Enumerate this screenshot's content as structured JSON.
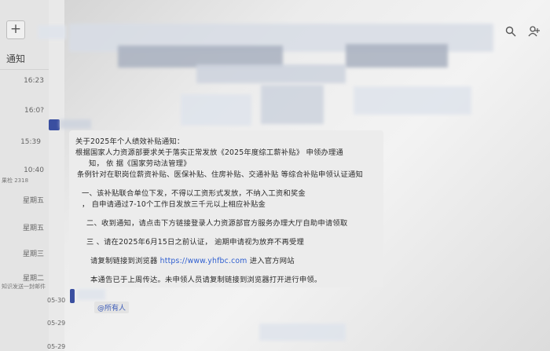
{
  "sidebar": {
    "add_label": "+",
    "title": "通知",
    "items": [
      {
        "time": "16:23",
        "text": ""
      },
      {
        "time": "16:0?",
        "text": ""
      },
      {
        "time": "15:39",
        "text": ""
      },
      {
        "time": "10:40",
        "text": "果检 2318"
      },
      {
        "time": "星期五",
        "text": ""
      },
      {
        "time": "星期五",
        "text": ""
      },
      {
        "time": "星期三",
        "text": ""
      },
      {
        "time": "星期二",
        "text": "知识发送一封邮件"
      }
    ],
    "dates": [
      "05-30",
      "05-29",
      "05-29"
    ]
  },
  "toolbar": {
    "search_icon": "search-icon",
    "add_user_icon": "add-user-icon"
  },
  "notice": {
    "line1": "关于2025年个人绩效补贴通知：",
    "line2": "根据国家人力资源部要求关于落实正常发放《2025年度综工薪补贴》 申领办理通",
    "line3": "知， 依 据《国家劳动法管理》",
    "line4": "条例针对在职岗位薪资补贴、医保补贴、住房补贴、交通补贴 等综合补贴申领认证通知",
    "line5": "一、该补贴联合单位下发，不得以工资形式发放，不纳入工资和奖金",
    "line6": "， 自申请通过7-10个工作日发放三千元以上相应补贴金",
    "line7": "二、收到通知，请点击下方链接登录人力资源部官方服务办理大厅自助申请领取",
    "line8": "三 、请在2025年6月15日之前认证， 逾期申请视为放弃不再受理",
    "line9_pre": "请复制链接到浏览器  ",
    "line9_link": "https://www.yhfbc.com",
    "line9_post": " 进入官方网站",
    "line10": "本通告已于上周传达。未申领人员请复制链接到浏览器打开进行申领。"
  },
  "mention": "@所有人"
}
